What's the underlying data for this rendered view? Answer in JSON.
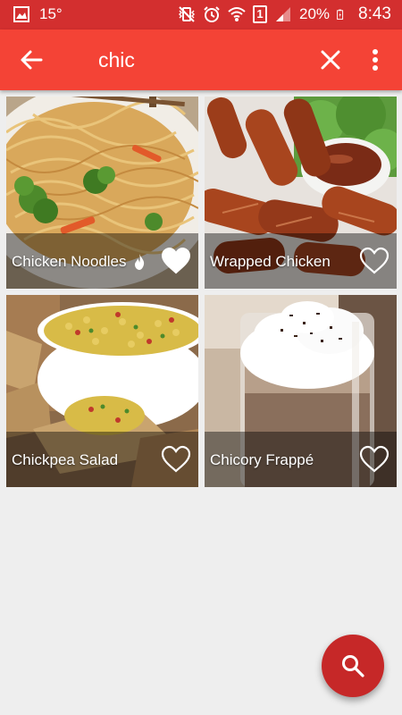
{
  "status_bar": {
    "temperature": "15°",
    "sim_slot": "1",
    "battery": "20%",
    "time": "8:43"
  },
  "search_bar": {
    "query": "chic"
  },
  "recipes": [
    {
      "title": "Chicken Noodles",
      "favorited": true,
      "spicy": true
    },
    {
      "title": "Wrapped Chicken",
      "favorited": false,
      "spicy": false
    },
    {
      "title": "Chickpea Salad",
      "favorited": false,
      "spicy": false
    },
    {
      "title": "Chicory Frappé",
      "favorited": false,
      "spicy": false
    }
  ],
  "icons": {
    "back": "arrow-left-icon",
    "clear": "close-icon",
    "more": "more-vert-icon",
    "search": "search-icon"
  },
  "colors": {
    "status_bar": "#d32f2f",
    "app_bar": "#f44336",
    "fab": "#c62828",
    "background": "#eeeeee"
  }
}
